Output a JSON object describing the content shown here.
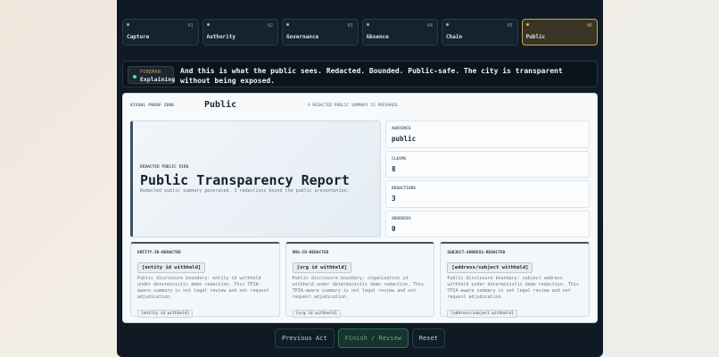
{
  "steps": [
    {
      "label": "Capture",
      "num": "01"
    },
    {
      "label": "Authority",
      "num": "02"
    },
    {
      "label": "Governance",
      "num": "03"
    },
    {
      "label": "Absence",
      "num": "04"
    },
    {
      "label": "Chain",
      "num": "05"
    },
    {
      "label": "Public",
      "num": "06",
      "active": true
    }
  ],
  "foreman": {
    "role": "FOREMAN",
    "state": "Explaining",
    "narration": "And this is what the public sees. Redacted. Bounded. Public-safe. The city is transparent without being exposed."
  },
  "zone": {
    "label": "VISUAL PROOF ZONE",
    "title": "Public",
    "status": "A REDACTED PUBLIC SUMMARY IS PREPARED."
  },
  "hero": {
    "label": "REDACTED PUBLIC VIEW",
    "title": "Public Transparency Report",
    "desc": "Redacted public summary generated. 3 redactions bound the public presentation."
  },
  "stats": [
    {
      "label": "AUDIENCE",
      "value": "public"
    },
    {
      "label": "CLAIMS",
      "value": "8"
    },
    {
      "label": "REDACTIONS",
      "value": "3"
    },
    {
      "label": "ABSENCES",
      "value": "0"
    }
  ],
  "redactions": [
    {
      "key": "ENTITY-ID-REDACTED",
      "tag": "[entity id withheld]",
      "desc": "Public disclosure boundary: entity id withheld under deterministic demo redaction. This TPIA-aware summary is not legal review and not request adjudication.",
      "foot": "[entity id withheld]"
    },
    {
      "key": "ORG-ID-REDACTED",
      "tag": "[org id withheld]",
      "desc": "Public disclosure boundary: organization id withheld under deterministic demo redaction. This TPIA-aware summary is not legal review and not request adjudication.",
      "foot": "[org id withheld]"
    },
    {
      "key": "SUBJECT-ADDRESS-REDACTED",
      "tag": "[address/subject withheld]",
      "desc": "Public disclosure boundary: subject address withheld under deterministic demo redaction. This TPIA-aware summary is not legal review and not request adjudication.",
      "foot": "[address/subject withheld]"
    }
  ],
  "controls": {
    "prev": "Previous Act",
    "finish": "Finish / Review",
    "reset": "Reset"
  }
}
